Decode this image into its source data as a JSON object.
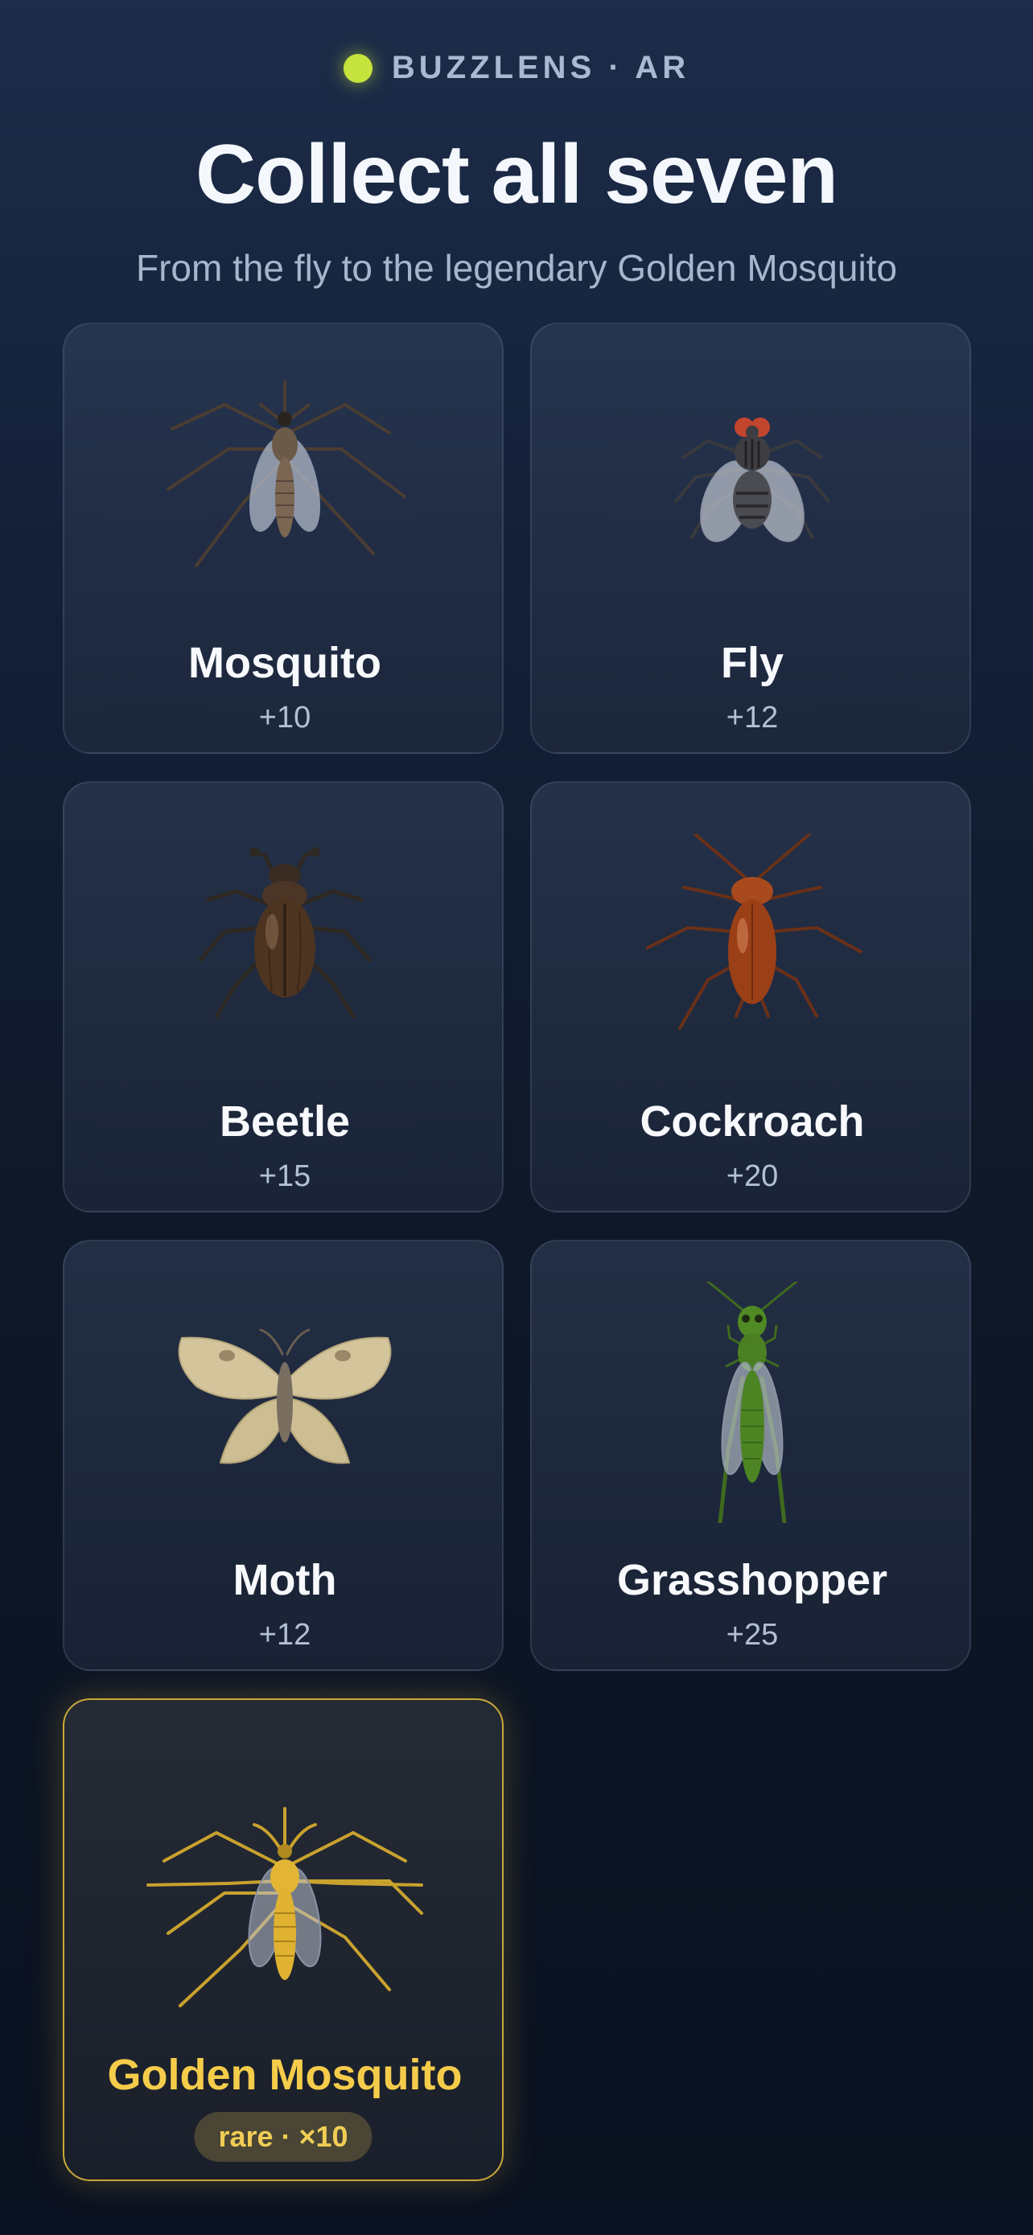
{
  "brand": {
    "text": "BUZZLENS · AR",
    "dot_color": "#c6e33d"
  },
  "header": {
    "title": "Collect all seven",
    "subtitle": "From the fly to the legendary Golden Mosquito"
  },
  "cards": [
    {
      "name": "Mosquito",
      "points": "+10",
      "icon": "mosquito-icon"
    },
    {
      "name": "Fly",
      "points": "+12",
      "icon": "fly-icon"
    },
    {
      "name": "Beetle",
      "points": "+15",
      "icon": "beetle-icon"
    },
    {
      "name": "Cockroach",
      "points": "+20",
      "icon": "cockroach-icon"
    },
    {
      "name": "Moth",
      "points": "+12",
      "icon": "moth-icon"
    },
    {
      "name": "Grasshopper",
      "points": "+25",
      "icon": "grasshopper-icon"
    },
    {
      "name": "Golden Mosquito",
      "badge": "rare · ×10",
      "icon": "golden-mosquito-icon",
      "accent": "#f5cc4a"
    }
  ]
}
